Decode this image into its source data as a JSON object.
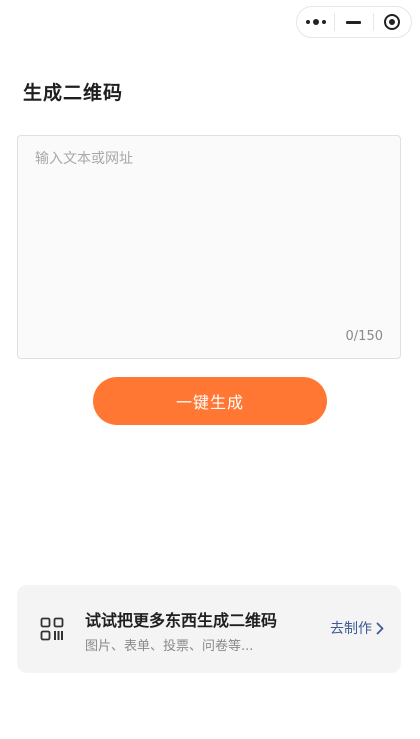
{
  "capsule": {
    "more_icon": "more-dots-icon",
    "minimize_icon": "minimize-icon",
    "close_icon": "close-circle-icon"
  },
  "page": {
    "title": "生成二维码"
  },
  "input": {
    "value": "",
    "placeholder": "输入文本或网址",
    "char_count": "0/150"
  },
  "generate_button": {
    "label": "一键生成"
  },
  "promo": {
    "icon": "qr-grid-icon",
    "title": "试试把更多东西生成二维码",
    "subtitle": "图片、表单、投票、问卷等...",
    "link_label": "去制作",
    "link_icon": "chevron-right-icon"
  },
  "colors": {
    "accent": "#ff7733",
    "link": "#3f5a96",
    "card_bg": "#f4f4f4",
    "input_bg": "#fafafa"
  }
}
